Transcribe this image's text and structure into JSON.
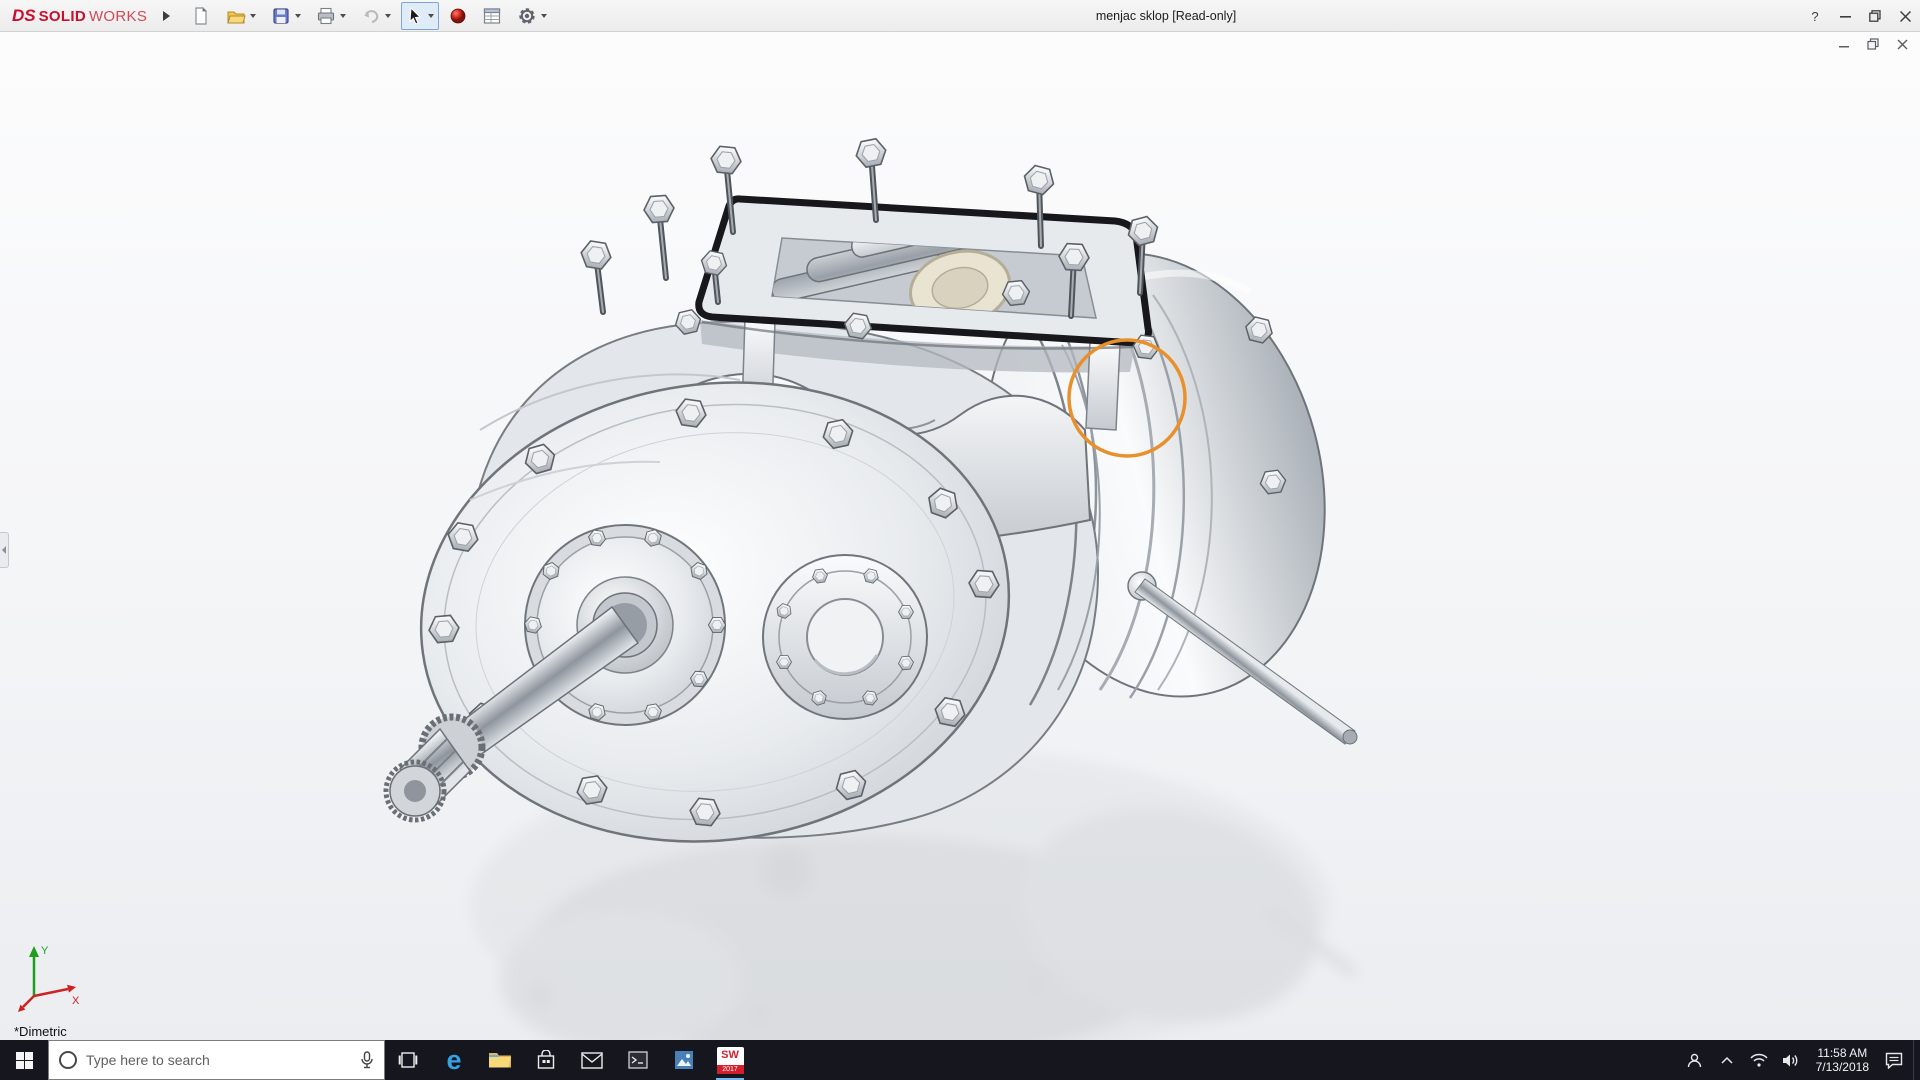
{
  "titlebar": {
    "brand": {
      "monogram": "DS",
      "solid": "SOLID",
      "works": "WORKS"
    },
    "title": "menjac sklop [Read-only]",
    "controls": {
      "help": "?"
    }
  },
  "toolbar": {
    "icons": [
      "new-document",
      "open",
      "save",
      "print",
      "undo",
      "select",
      "rebuild",
      "file-properties",
      "options"
    ]
  },
  "viewport": {
    "view_label": "*Dimetric",
    "annotation_color": "#E8902C",
    "triad": {
      "x_label": "X",
      "y_label": "Y"
    }
  },
  "taskbar": {
    "search_placeholder": "Type here to search",
    "edge_glyph": "e",
    "solidworks": {
      "label": "SW",
      "year": "2017"
    },
    "clock": {
      "time": "11:58 AM",
      "date": "7/13/2018"
    }
  }
}
